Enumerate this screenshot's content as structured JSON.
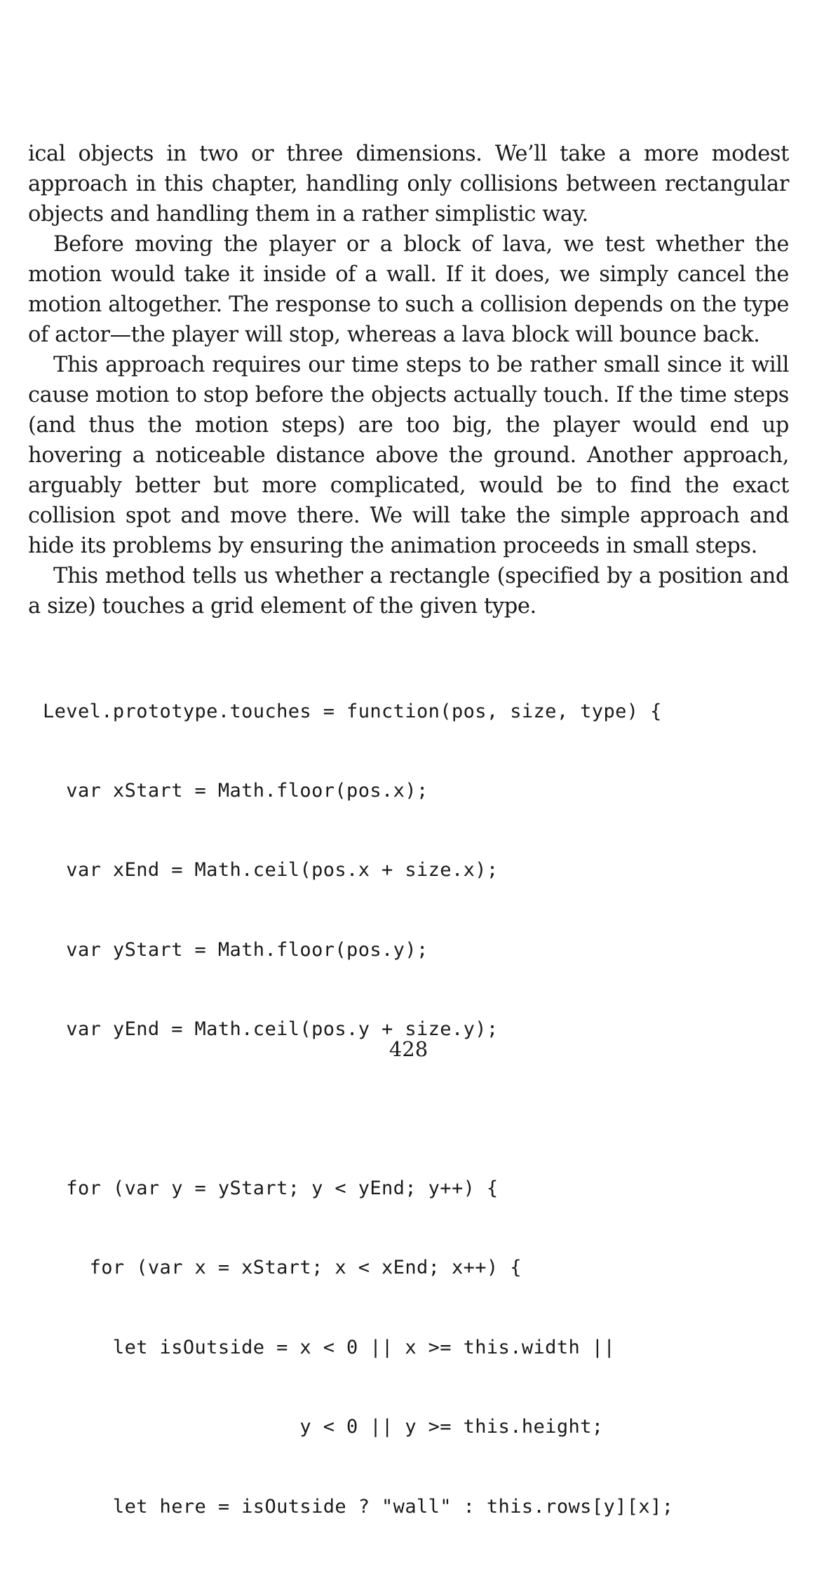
{
  "paragraphs": [
    "ical objects in two or three dimensions. We’ll take a more modest approach in this chapter, handling only collisions between rectangular objects and handling them in a rather simplistic way.",
    "Before moving the player or a block of lava, we test whether the motion would take it inside of a wall. If it does, we simply cancel the motion altogether. The response to such a collision depends on the type of actor—the player will stop, whereas a lava block will bounce back.",
    "This approach requires our time steps to be rather small since it will cause motion to stop before the objects actually touch. If the time steps (and thus the motion steps) are too big, the player would end up hovering a noticeable distance above the ground. Another approach, arguably better but more complicated, would be to find the exact collision spot and move there. We will take the simple approach and hide its problems by ensuring the animation proceeds in small steps.",
    "This method tells us whether a rectangle (specified by a position and a size) touches a grid element of the given type."
  ],
  "code_lines": [
    "Level.prototype.touches = function(pos, size, type) {",
    "  var xStart = Math.floor(pos.x);",
    "  var xEnd = Math.ceil(pos.x + size.x);",
    "  var yStart = Math.floor(pos.y);",
    "  var yEnd = Math.ceil(pos.y + size.y);",
    "",
    "  for (var y = yStart; y < yEnd; y++) {",
    "    for (var x = xStart; x < xEnd; x++) {",
    "      let isOutside = x < 0 || x >= this.width ||",
    "                      y < 0 || y >= this.height;",
    "      let here = isOutside ? \"wall\" : this.rows[y][x];"
  ],
  "page_number": "428"
}
